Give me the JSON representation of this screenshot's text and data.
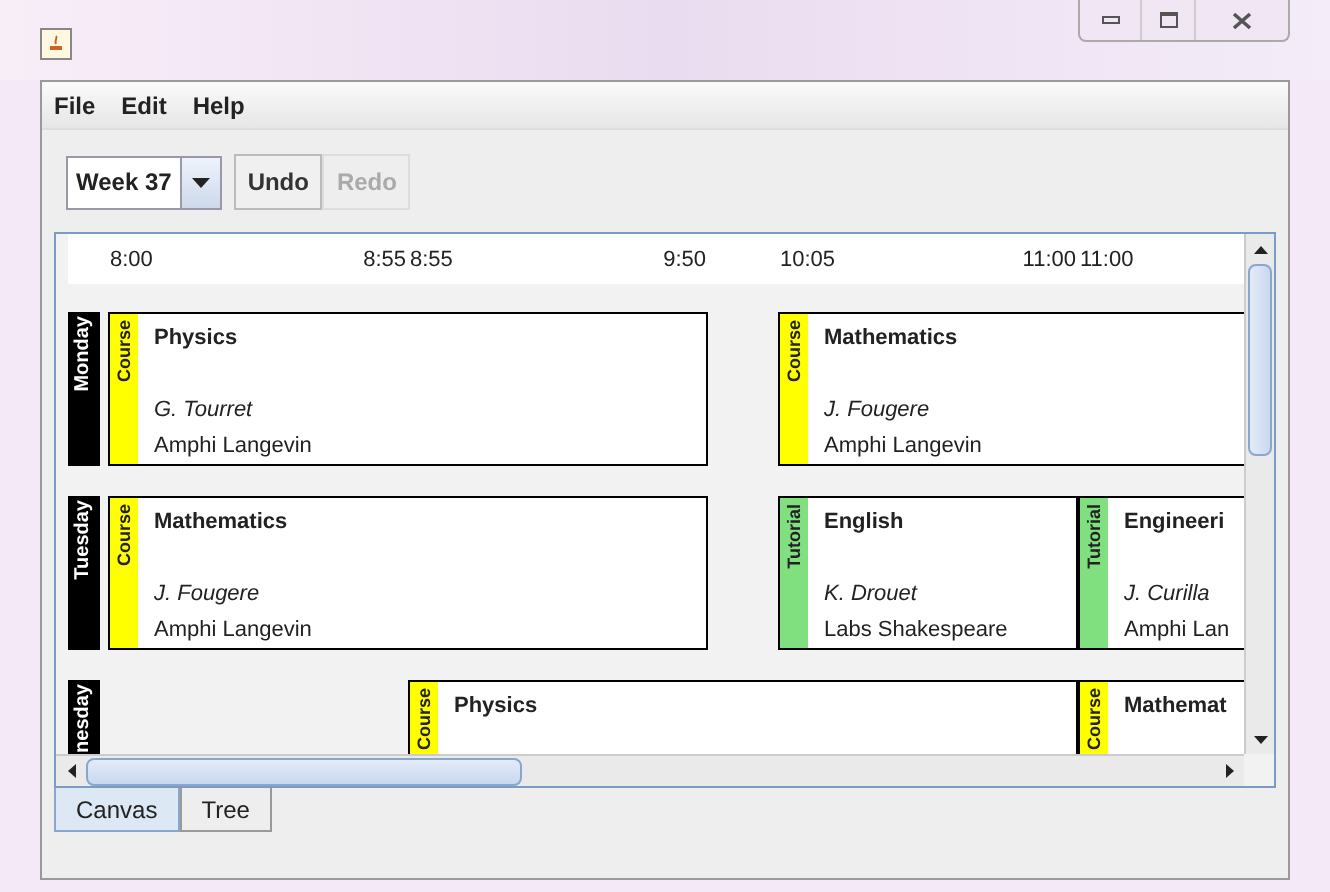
{
  "menu": [
    "File",
    "Edit",
    "Help"
  ],
  "toolbar": {
    "week": "Week 37",
    "buttons": [
      {
        "label": "Undo",
        "disabled": false
      },
      {
        "label": "Redo",
        "disabled": true
      }
    ]
  },
  "columns": [
    {
      "kind": "period",
      "start": "8:00",
      "end": "8:55"
    },
    {
      "kind": "period",
      "start": "8:55",
      "end": "9:50"
    },
    {
      "kind": "break"
    },
    {
      "kind": "period",
      "start": "10:05",
      "end": "11:00"
    },
    {
      "kind": "period",
      "start": "11:00"
    }
  ],
  "days": [
    {
      "name": "Monday",
      "cells": [
        {
          "kind": "event",
          "type": "Course",
          "color": "#ffff00",
          "title": "Physics",
          "teacher": "G. Tourret",
          "room": "Amphi Langevin"
        },
        {
          "kind": "continued"
        },
        {
          "kind": "free"
        },
        {
          "kind": "event",
          "type": "Course",
          "color": "#ffff00",
          "title": "Mathematics",
          "teacher": "J. Fougere",
          "room": "Amphi Langevin"
        },
        {
          "kind": "continued"
        }
      ]
    },
    {
      "name": "Tuesday",
      "cells": [
        {
          "kind": "event",
          "type": "Course",
          "color": "#ffff00",
          "title": "Mathematics",
          "teacher": "J. Fougere",
          "room": "Amphi Langevin"
        },
        {
          "kind": "continued"
        },
        {
          "kind": "free"
        },
        {
          "kind": "event",
          "type": "Tutorial",
          "color": "#80e080",
          "title": "English",
          "teacher": "K. Drouet",
          "room": "Labs Shakespeare"
        },
        {
          "kind": "event",
          "type": "Tutorial",
          "color": "#80e080",
          "title": "Engineeri",
          "teacher": "J. Curilla",
          "room": "Amphi Lan"
        }
      ]
    },
    {
      "name": "nesday",
      "cells": [
        {
          "kind": "free"
        },
        {
          "kind": "event",
          "type": "Course",
          "color": "#ffff00",
          "title": "Physics"
        },
        {
          "kind": "continued"
        },
        {
          "kind": "continued"
        },
        {
          "kind": "event",
          "type": "Course",
          "color": "#ffff00",
          "title": "Mathemat"
        }
      ]
    }
  ],
  "tabs": [
    {
      "label": "Canvas",
      "selected": true
    },
    {
      "label": "Tree",
      "selected": false
    }
  ]
}
